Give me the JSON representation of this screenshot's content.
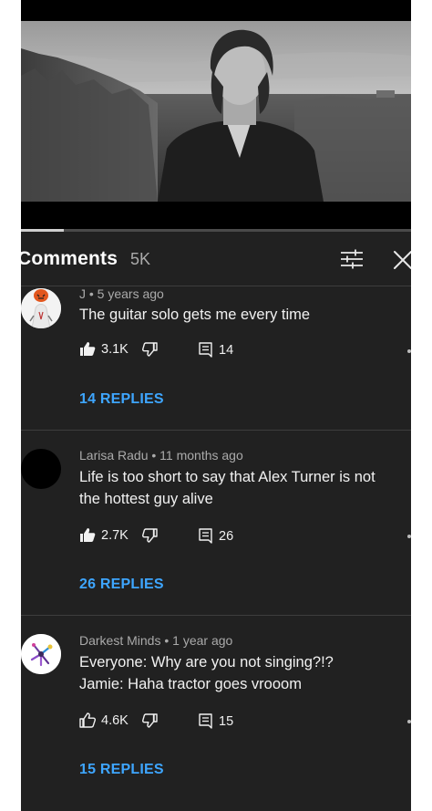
{
  "video": {
    "progress": 0.11
  },
  "comments_panel": {
    "title": "Comments",
    "count": "5K"
  },
  "comments": [
    {
      "author": "J",
      "time": "5 years ago",
      "meta": "J • 5 years ago",
      "text_lines": [
        "The guitar solo gets me every time"
      ],
      "likes": "3.1K",
      "like_filled": true,
      "reply_count": "14",
      "replies_label": "14 REPLIES"
    },
    {
      "author": "Larisa Radu",
      "time": "11 months ago",
      "meta": "Larisa Radu • 11 months ago",
      "text_lines": [
        "Life is too short to say that Alex Turner is not",
        "the hottest guy alive"
      ],
      "likes": "2.7K",
      "like_filled": true,
      "reply_count": "26",
      "replies_label": "26 REPLIES"
    },
    {
      "author": "Darkest Minds",
      "time": "1 year ago",
      "meta": "Darkest Minds • 1 year ago",
      "text_lines": [
        "Everyone: Why are you not singing?!?",
        "Jamie: Haha tractor goes vrooom"
      ],
      "likes": "4.6K",
      "like_filled": false,
      "reply_count": "15",
      "replies_label": "15 REPLIES"
    }
  ],
  "icons": {
    "sort": "sort-filter-icon",
    "close": "close-icon",
    "like": "thumbs-up-icon",
    "dislike": "thumbs-down-icon",
    "reply": "reply-icon"
  },
  "colors": {
    "background": "#212121",
    "link": "#3ea6ff",
    "secondary_text": "#aaaaaa"
  }
}
